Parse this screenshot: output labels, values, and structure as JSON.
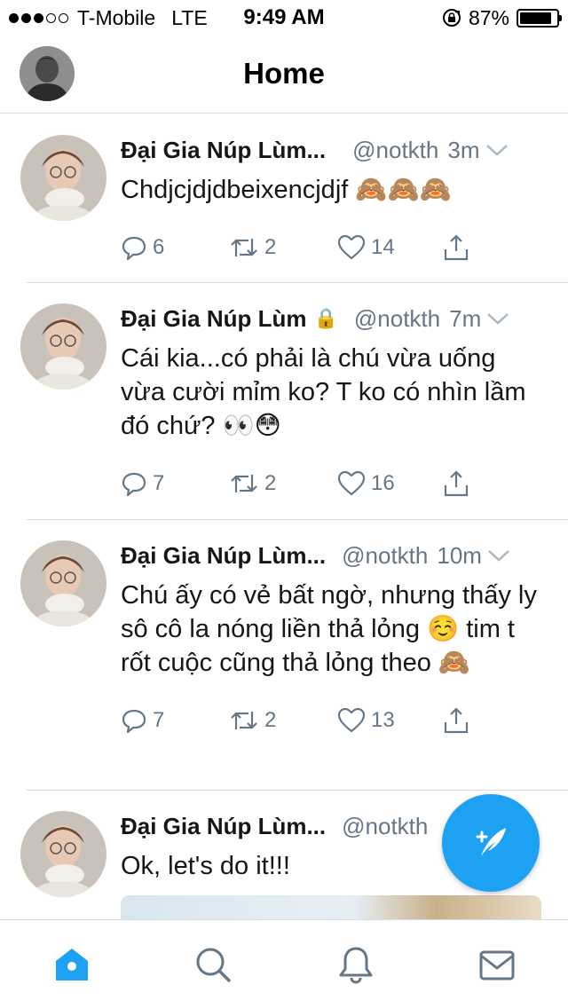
{
  "status_bar": {
    "carrier": "T-Mobile",
    "network": "LTE",
    "time": "9:49 AM",
    "battery_percent": "87%",
    "battery_level": 0.87,
    "signal_bars": 3,
    "signal_total": 5
  },
  "header": {
    "title": "Home"
  },
  "colors": {
    "accent": "#1da1f2",
    "secondary_text": "#657786",
    "divider": "#d5dbe0"
  },
  "tweets": [
    {
      "name": "Đại Gia Núp Lùm...",
      "handle": "@notkth",
      "time": "3m",
      "locked": false,
      "text": "Chdjcjdjdbeixencjdjf 🙈🙈🙈",
      "replies": "6",
      "retweets": "2",
      "likes": "14"
    },
    {
      "name": "Đại Gia Núp Lùm",
      "handle": "@notkth",
      "time": "7m",
      "locked": true,
      "lock_icon": "🔒",
      "text": "Cái kia...có phải là chú vừa uống vừa cười mỉm ko? T ko có nhìn lầm đó chứ? 👀😳",
      "replies": "7",
      "retweets": "2",
      "likes": "16"
    },
    {
      "name": "Đại Gia Núp Lùm...",
      "handle": "@notkth",
      "time": "10m",
      "locked": false,
      "text": "Chú ấy có vẻ bất ngờ, nhưng thấy ly sô cô la nóng liền thả lỏng ☺️  tim t rốt cuộc cũng thả lỏng theo 🙈",
      "replies": "7",
      "retweets": "2",
      "likes": "13"
    },
    {
      "name": "Đại Gia Núp Lùm...",
      "handle": "@notkth",
      "time": "",
      "locked": false,
      "text": "Ok, let's do it!!!",
      "has_photo": true
    }
  ],
  "tab_bar": {
    "items": [
      "home-icon",
      "search-icon",
      "notifications-icon",
      "messages-icon"
    ],
    "active": "home-icon"
  },
  "fab": {
    "icon": "compose-tweet-icon"
  }
}
